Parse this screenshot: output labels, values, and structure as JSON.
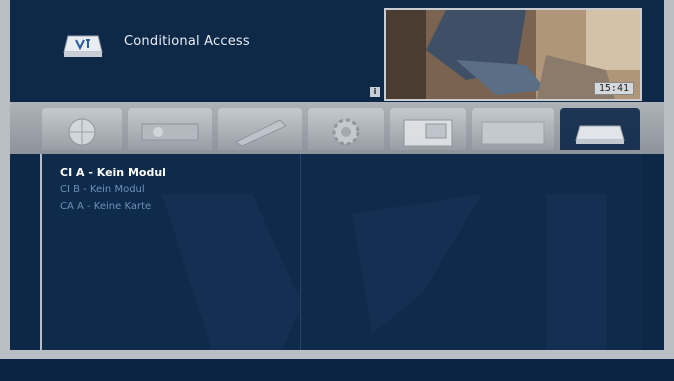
{
  "header": {
    "title": "Conditional Access",
    "logo_icon": "ci-module-icon",
    "info_badge": "i"
  },
  "preview": {
    "clock": "15:41"
  },
  "tabs": [
    {
      "icon": "globe-icon",
      "active": false
    },
    {
      "icon": "satellite-icon",
      "active": false
    },
    {
      "icon": "pen-icon",
      "active": false
    },
    {
      "icon": "gear-icon",
      "active": false
    },
    {
      "icon": "screen-icon",
      "active": false
    },
    {
      "icon": "blank-icon",
      "active": false
    },
    {
      "icon": "ci-module-icon",
      "active": true
    }
  ],
  "list": {
    "items": [
      {
        "label": "CI A - Kein Modul",
        "selected": true
      },
      {
        "label": "CI B - Kein Modul",
        "selected": false
      },
      {
        "label": "CA A - Keine Karte",
        "selected": false
      }
    ]
  },
  "colors": {
    "background": "#0d2747",
    "panel": "#0f2b4c",
    "chrome": "#b9bec4",
    "selected_text": "#ffffff",
    "muted_text": "#6f8fb8"
  }
}
